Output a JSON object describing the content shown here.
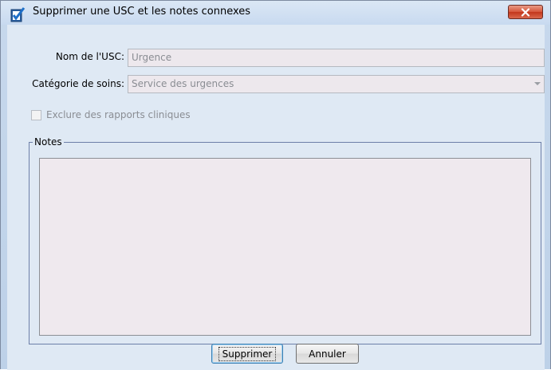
{
  "window": {
    "title": "Supprimer une USC et les notes connexes"
  },
  "form": {
    "nom_label": "Nom de l'USC:",
    "nom_value": "Urgence",
    "categorie_label": "Catégorie de soins:",
    "categorie_value": "Service des urgences",
    "exclure_label": "Exclure des rapports cliniques",
    "notes_legend": "Notes",
    "notes_value": ""
  },
  "buttons": {
    "delete_label": "Supprimer",
    "cancel_label": "Annuler"
  },
  "icons": {
    "title": "checklist-icon",
    "close": "close-icon",
    "dropdown": "chevron-down-icon"
  },
  "colors": {
    "close_button": "#c2371c",
    "fieldset_border": "#6d7fa8",
    "disabled_field_bg": "#ede8ed"
  }
}
